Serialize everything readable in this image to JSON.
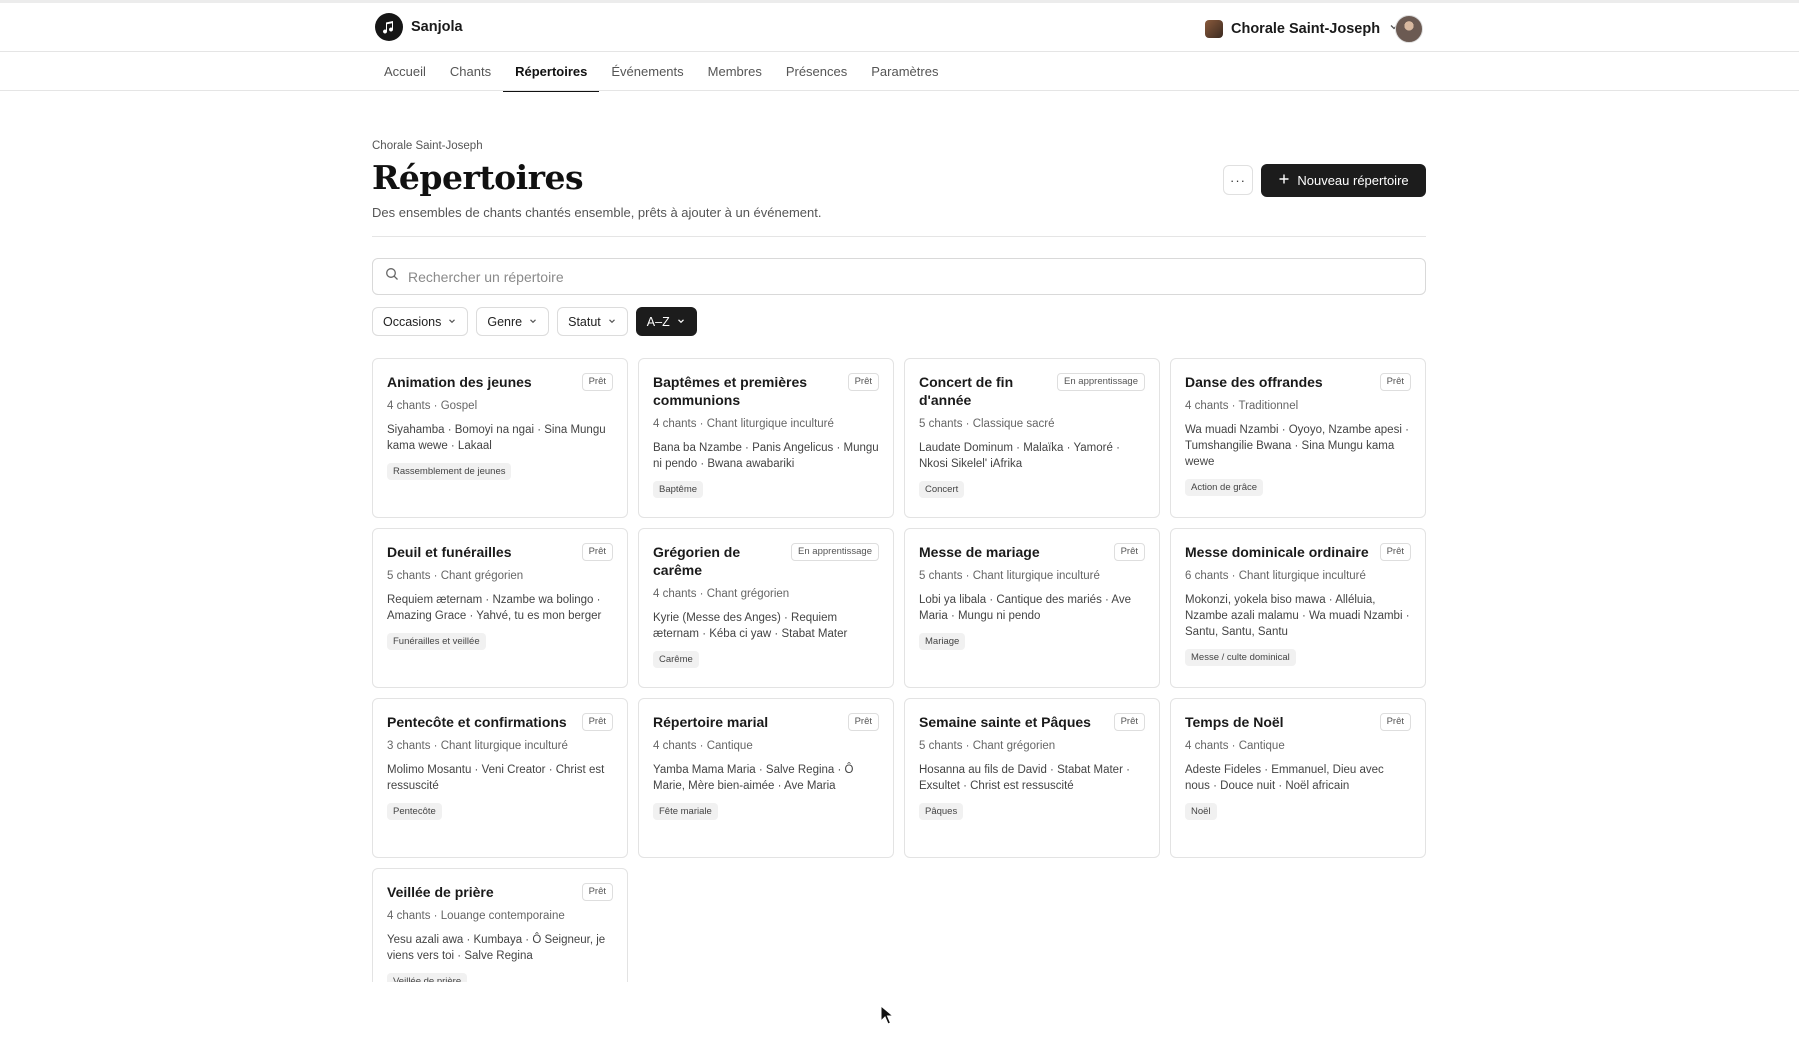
{
  "brand": {
    "name": "Sanjola"
  },
  "org": {
    "name": "Chorale Saint-Joseph"
  },
  "nav": {
    "tabs": [
      "Accueil",
      "Chants",
      "Répertoires",
      "Événements",
      "Membres",
      "Présences",
      "Paramètres"
    ],
    "active": "Répertoires"
  },
  "header": {
    "breadcrumb": "Chorale Saint-Joseph",
    "title": "Répertoires",
    "subtitle": "Des ensembles de chants chantés ensemble, prêts à ajouter à un événement.",
    "more_label": "···",
    "new_button": "Nouveau répertoire"
  },
  "search": {
    "placeholder": "Rechercher un répertoire",
    "value": ""
  },
  "filters": [
    {
      "label": "Occasions",
      "active": false
    },
    {
      "label": "Genre",
      "active": false
    },
    {
      "label": "Statut",
      "active": false
    },
    {
      "label": "A–Z",
      "active": true
    }
  ],
  "repertoires": [
    {
      "title": "Animation des jeunes",
      "status": "Prêt",
      "meta": "4 chants · Gospel",
      "songs": "Siyahamba · Bomoyi na ngai · Sina Mungu kama wewe · Lakaal",
      "tag": "Rassemblement de jeunes"
    },
    {
      "title": "Baptêmes et premières communions",
      "status": "Prêt",
      "meta": "4 chants · Chant liturgique inculturé",
      "songs": "Bana ba Nzambe · Panis Angelicus · Mungu ni pendo · Bwana awabariki",
      "tag": "Baptême"
    },
    {
      "title": "Concert de fin d'année",
      "status": "En apprentissage",
      "meta": "5 chants · Classique sacré",
      "songs": "Laudate Dominum · Malaïka · Yamoré · Nkosi Sikelel' iAfrika",
      "tag": "Concert"
    },
    {
      "title": "Danse des offrandes",
      "status": "Prêt",
      "meta": "4 chants · Traditionnel",
      "songs": "Wa muadi Nzambi · Oyoyo, Nzambe apesi · Tumshangilie Bwana · Sina Mungu kama wewe",
      "tag": "Action de grâce"
    },
    {
      "title": "Deuil et funérailles",
      "status": "Prêt",
      "meta": "5 chants · Chant grégorien",
      "songs": "Requiem æternam · Nzambe wa bolingo · Amazing Grace · Yahvé, tu es mon berger",
      "tag": "Funérailles et veillée"
    },
    {
      "title": "Grégorien de carême",
      "status": "En apprentissage",
      "meta": "4 chants · Chant grégorien",
      "songs": "Kyrie (Messe des Anges) · Requiem æternam · Kéba ci yaw · Stabat Mater",
      "tag": "Carême"
    },
    {
      "title": "Messe de mariage",
      "status": "Prêt",
      "meta": "5 chants · Chant liturgique inculturé",
      "songs": "Lobi ya libala · Cantique des mariés · Ave Maria · Mungu ni pendo",
      "tag": "Mariage"
    },
    {
      "title": "Messe dominicale ordinaire",
      "status": "Prêt",
      "meta": "6 chants · Chant liturgique inculturé",
      "songs": "Mokonzi, yokela biso mawa · Alléluia, Nzambe azali malamu · Wa muadi Nzambi · Santu, Santu, Santu",
      "tag": "Messe / culte dominical"
    },
    {
      "title": "Pentecôte et confirmations",
      "status": "Prêt",
      "meta": "3 chants · Chant liturgique inculturé",
      "songs": "Molimo Mosantu · Veni Creator · Christ est ressuscité",
      "tag": "Pentecôte"
    },
    {
      "title": "Répertoire marial",
      "status": "Prêt",
      "meta": "4 chants · Cantique",
      "songs": "Yamba Mama Maria · Salve Regina · Ô Marie, Mère bien-aimée · Ave Maria",
      "tag": "Fête mariale"
    },
    {
      "title": "Semaine sainte et Pâques",
      "status": "Prêt",
      "meta": "5 chants · Chant grégorien",
      "songs": "Hosanna au fils de David · Stabat Mater · Exsultet · Christ est ressuscité",
      "tag": "Pâques"
    },
    {
      "title": "Temps de Noël",
      "status": "Prêt",
      "meta": "4 chants · Cantique",
      "songs": "Adeste Fideles · Emmanuel, Dieu avec nous · Douce nuit · Noël africain",
      "tag": "Noël"
    },
    {
      "title": "Veillée de prière",
      "status": "Prêt",
      "meta": "4 chants · Louange contemporaine",
      "songs": "Yesu azali awa · Kumbaya · Ô Seigneur, je viens vers toi · Salve Regina",
      "tag": "Veillée de prière"
    }
  ]
}
